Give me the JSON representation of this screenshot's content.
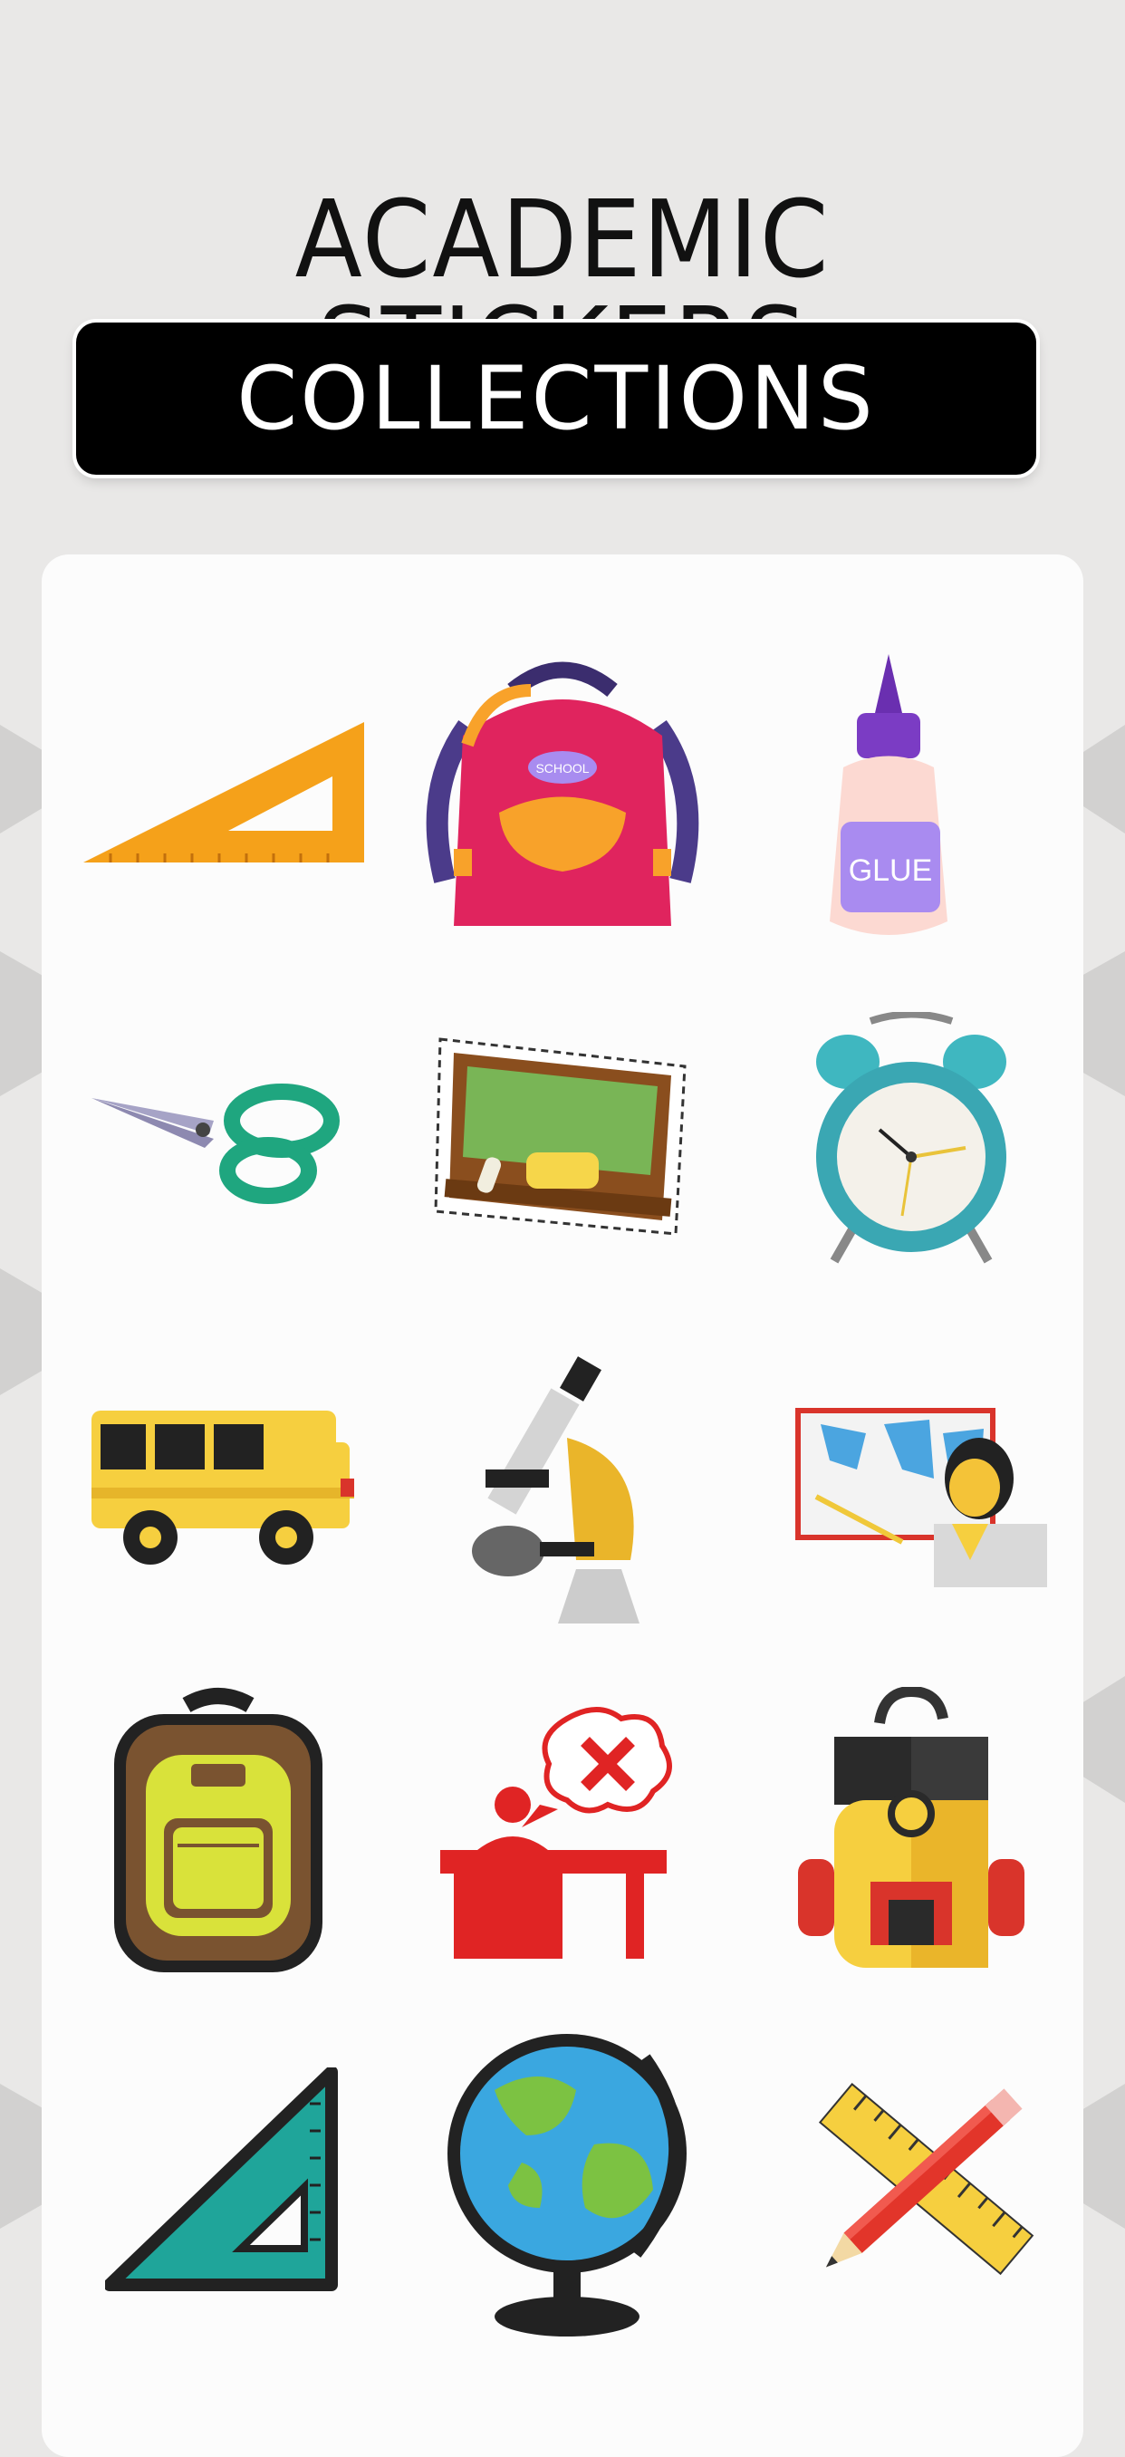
{
  "header": {
    "title": "ACADEMIC STICKERS",
    "subtitle": "COLLECTIONS"
  },
  "stickers": [
    {
      "icon": "set-square-ruler-icon"
    },
    {
      "icon": "school-backpack-icon",
      "label": "SCHOOL"
    },
    {
      "icon": "glue-bottle-icon",
      "label": "GLUE"
    },
    {
      "icon": "scissors-icon"
    },
    {
      "icon": "chalkboard-icon"
    },
    {
      "icon": "alarm-clock-icon"
    },
    {
      "icon": "school-bus-icon"
    },
    {
      "icon": "microscope-icon"
    },
    {
      "icon": "teacher-map-icon"
    },
    {
      "icon": "brown-backpack-icon"
    },
    {
      "icon": "teacher-desk-wrong-icon"
    },
    {
      "icon": "yellow-backpack-icon"
    },
    {
      "icon": "triangle-ruler-icon"
    },
    {
      "icon": "globe-icon"
    },
    {
      "icon": "pencil-ruler-icon"
    }
  ],
  "colors": {
    "background": "#e9e8e7",
    "card": "#fcfcfc",
    "pill": "#000000"
  }
}
